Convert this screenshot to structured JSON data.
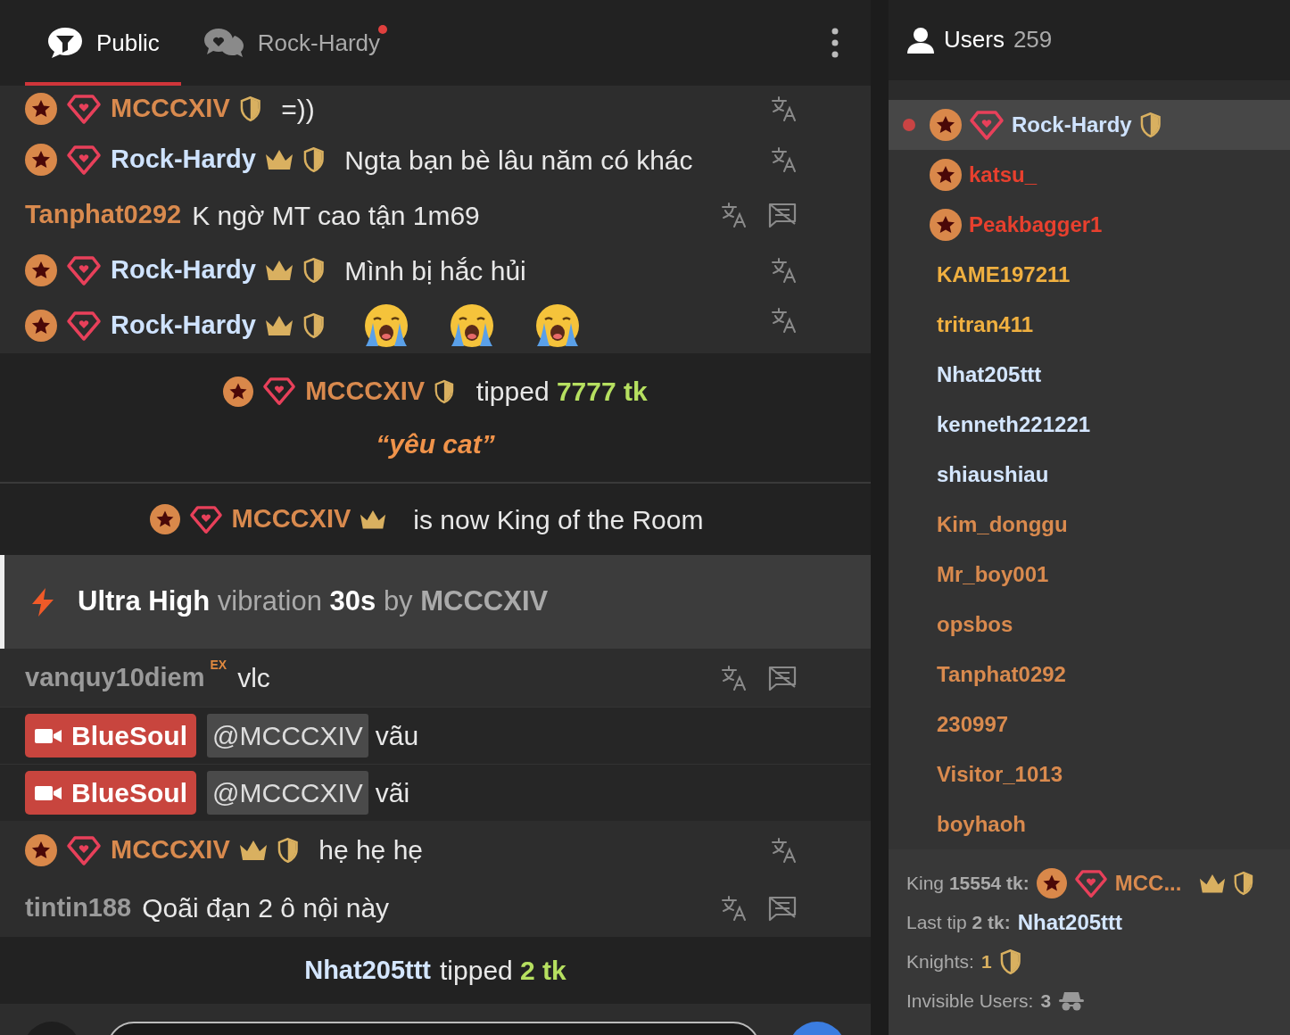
{
  "chat_tabs": [
    {
      "label": "Public",
      "selected": true,
      "kind": "public"
    },
    {
      "label": "Rock-Hardy",
      "selected": false,
      "kind": "private",
      "unread": true
    }
  ],
  "messages": [
    {
      "kind": "chat",
      "user": {
        "name": "MCCCXIV",
        "color": "#d98a4e",
        "star": true,
        "diamond": true,
        "crown": false,
        "shield": true
      },
      "text": "=))",
      "translate": true,
      "hide": false
    },
    {
      "kind": "chat",
      "user": {
        "name": "Rock-Hardy",
        "color": "#cfe3ff",
        "star": true,
        "diamond": true,
        "crown": true,
        "shield": true
      },
      "text": "Ngta bạn bè lâu năm có khác",
      "translate": true,
      "hide": false
    },
    {
      "kind": "chat",
      "user": {
        "name": "Tanphat0292",
        "color": "#d98a4e",
        "star": false,
        "diamond": false,
        "crown": false,
        "shield": false
      },
      "text": "K ngờ MT cao tận 1m69",
      "translate": true,
      "hide": true
    },
    {
      "kind": "chat",
      "user": {
        "name": "Rock-Hardy",
        "color": "#cfe3ff",
        "star": true,
        "diamond": true,
        "crown": true,
        "shield": true
      },
      "text": "Mình bị hắc hủi",
      "translate": true,
      "hide": false
    },
    {
      "kind": "emoji",
      "user": {
        "name": "Rock-Hardy",
        "color": "#cfe3ff",
        "star": true,
        "diamond": true,
        "crown": true,
        "shield": true
      },
      "emojis": [
        {
          "kind": "crying"
        },
        {
          "kind": "crying"
        },
        {
          "kind": "crying"
        }
      ],
      "translate": true,
      "hide": false
    },
    {
      "kind": "tip",
      "user": {
        "name": "MCCCXIV",
        "color": "#d98a4e",
        "star": true,
        "diamond": true,
        "crown": false,
        "shield": true
      },
      "verb": "tipped",
      "amount": "7777 tk",
      "note": "“yêu cat”"
    },
    {
      "kind": "king",
      "user": {
        "name": "MCCCXIV",
        "color": "#d98a4e",
        "star": true,
        "diamond": true,
        "crown": true,
        "shield": false
      },
      "text": "is now King of the Room"
    },
    {
      "kind": "vibration",
      "strength": "Ultra High",
      "text": "vibration",
      "duration": "30s",
      "by": "by",
      "by_user": "MCCCXIV"
    },
    {
      "kind": "chat",
      "user": {
        "name": "vanquy10diem",
        "color": "#9a9a9a",
        "star": false,
        "diamond": false,
        "crown": false,
        "shield": false,
        "tag": "EX"
      },
      "text": "vlc",
      "translate": true,
      "hide": true
    },
    {
      "kind": "broadcaster",
      "user": {
        "name": "BlueSoul"
      },
      "mention": "@MCCCXIV",
      "text": "vãu"
    },
    {
      "kind": "broadcaster",
      "user": {
        "name": "BlueSoul"
      },
      "mention": "@MCCCXIV",
      "text": "vãi"
    },
    {
      "kind": "chat",
      "user": {
        "name": "MCCCXIV",
        "color": "#d98a4e",
        "star": true,
        "diamond": true,
        "crown": true,
        "shield": true
      },
      "text": "hẹ hẹ hẹ",
      "translate": true,
      "hide": false
    },
    {
      "kind": "chat",
      "user": {
        "name": "tintin188",
        "color": "#9a9a9a",
        "star": false,
        "diamond": false,
        "crown": false,
        "shield": false
      },
      "text": "Qoãi đạn 2 ô nội này",
      "translate": true,
      "hide": true
    },
    {
      "kind": "tip",
      "user": {
        "name": "Nhat205ttt",
        "color": "#d4e6ff",
        "star": false,
        "diamond": false,
        "crown": false,
        "shield": false
      },
      "verb": "tipped",
      "amount": "2 tk"
    }
  ],
  "users": {
    "title": "Users",
    "count": "259",
    "items": [
      {
        "name": "Rock-Hardy",
        "color": "#cfe3ff",
        "selected": true,
        "marked": true,
        "star": true,
        "diamond": true,
        "shield": true
      },
      {
        "name": "katsu_",
        "color": "#e8402e",
        "selected": false,
        "marked": false,
        "star": true,
        "diamond": false,
        "shield": false
      },
      {
        "name": "Peakbagger1",
        "color": "#e8402e",
        "selected": false,
        "marked": false,
        "star": true,
        "diamond": false,
        "shield": false
      },
      {
        "name": "KAME197211",
        "color": "#f0b040",
        "selected": false,
        "marked": false,
        "star": false,
        "diamond": false,
        "shield": false
      },
      {
        "name": "tritran411",
        "color": "#f0b040",
        "selected": false,
        "marked": false,
        "star": false,
        "diamond": false,
        "shield": false
      },
      {
        "name": "Nhat205ttt",
        "color": "#d4e6ff",
        "selected": false,
        "marked": false,
        "star": false,
        "diamond": false,
        "shield": false
      },
      {
        "name": "kenneth221221",
        "color": "#d4e6ff",
        "selected": false,
        "marked": false,
        "star": false,
        "diamond": false,
        "shield": false
      },
      {
        "name": "shiaushiau",
        "color": "#d4e6ff",
        "selected": false,
        "marked": false,
        "star": false,
        "diamond": false,
        "shield": false
      },
      {
        "name": "Kim_donggu",
        "color": "#d98a4e",
        "selected": false,
        "marked": false,
        "star": false,
        "diamond": false,
        "shield": false
      },
      {
        "name": "Mr_boy001",
        "color": "#d98a4e",
        "selected": false,
        "marked": false,
        "star": false,
        "diamond": false,
        "shield": false
      },
      {
        "name": "opsbos",
        "color": "#d98a4e",
        "selected": false,
        "marked": false,
        "star": false,
        "diamond": false,
        "shield": false
      },
      {
        "name": "Tanphat0292",
        "color": "#d98a4e",
        "selected": false,
        "marked": false,
        "star": false,
        "diamond": false,
        "shield": false
      },
      {
        "name": "230997",
        "color": "#d98a4e",
        "selected": false,
        "marked": false,
        "star": false,
        "diamond": false,
        "shield": false
      },
      {
        "name": "Visitor_1013",
        "color": "#d98a4e",
        "selected": false,
        "marked": false,
        "star": false,
        "diamond": false,
        "shield": false
      },
      {
        "name": "boyhaoh",
        "color": "#d98a4e",
        "selected": false,
        "marked": false,
        "star": false,
        "diamond": false,
        "shield": false
      }
    ]
  },
  "stats": {
    "king": {
      "label": "King",
      "amount": "15554 tk:",
      "user": {
        "name": "MCC...",
        "color": "#d98a4e",
        "star": true,
        "diamond": true,
        "crown": true,
        "shield": true
      }
    },
    "last_tip": {
      "label": "Last tip",
      "amount": "2 tk:",
      "user": {
        "name": "Nhat205ttt",
        "color": "#d4e6ff"
      }
    },
    "knights": {
      "label": "Knights:",
      "count": "1"
    },
    "invisible": {
      "label": "Invisible Users:",
      "count": "3"
    }
  }
}
